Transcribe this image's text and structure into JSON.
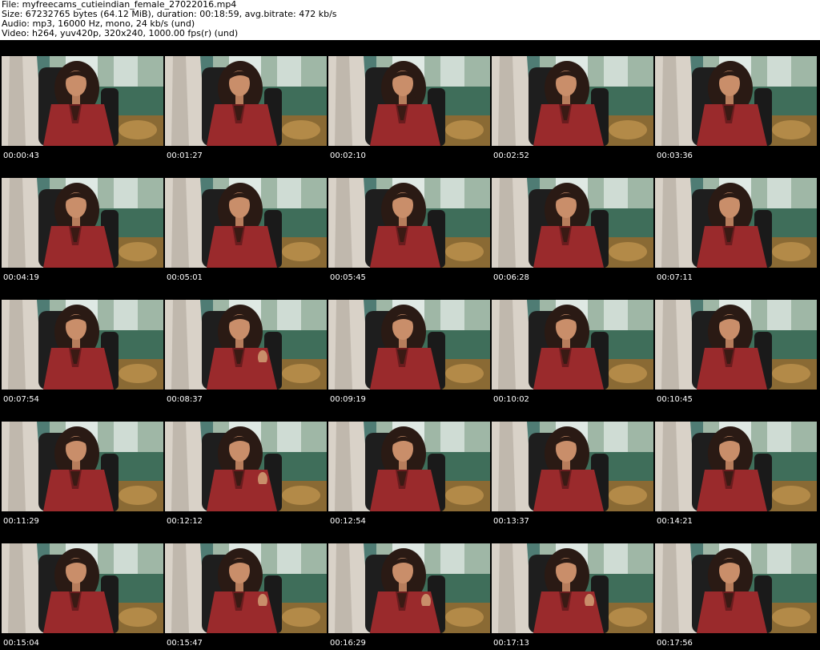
{
  "header": {
    "file_line": "File: myfreecams_cutieindian_female_27022016.mp4",
    "size_line": "Size: 67232765 bytes (64.12 MiB), duration: 00:18:59, avg.bitrate: 472 kb/s",
    "audio_line": "Audio: mp3, 16000 Hz, mono, 24 kb/s (und)",
    "video_line": "Video: h264, yuv420p, 320x240, 1000.00 fps(r) (und)"
  },
  "frames": [
    {
      "timestamp": "00:00:43",
      "pose": "neutral"
    },
    {
      "timestamp": "00:01:27",
      "pose": "neutral"
    },
    {
      "timestamp": "00:02:10",
      "pose": "neutral"
    },
    {
      "timestamp": "00:02:52",
      "pose": "neutral"
    },
    {
      "timestamp": "00:03:36",
      "pose": "neutral"
    },
    {
      "timestamp": "00:04:19",
      "pose": "neutral"
    },
    {
      "timestamp": "00:05:01",
      "pose": "neutral"
    },
    {
      "timestamp": "00:05:45",
      "pose": "neutral"
    },
    {
      "timestamp": "00:06:28",
      "pose": "neutral"
    },
    {
      "timestamp": "00:07:11",
      "pose": "neutral"
    },
    {
      "timestamp": "00:07:54",
      "pose": "neutral"
    },
    {
      "timestamp": "00:08:37",
      "pose": "hand"
    },
    {
      "timestamp": "00:09:19",
      "pose": "neutral"
    },
    {
      "timestamp": "00:10:02",
      "pose": "neutral"
    },
    {
      "timestamp": "00:10:45",
      "pose": "neutral"
    },
    {
      "timestamp": "00:11:29",
      "pose": "neutral"
    },
    {
      "timestamp": "00:12:12",
      "pose": "hand"
    },
    {
      "timestamp": "00:12:54",
      "pose": "neutral"
    },
    {
      "timestamp": "00:13:37",
      "pose": "neutral"
    },
    {
      "timestamp": "00:14:21",
      "pose": "neutral"
    },
    {
      "timestamp": "00:15:04",
      "pose": "neutral"
    },
    {
      "timestamp": "00:15:47",
      "pose": "hand"
    },
    {
      "timestamp": "00:16:29",
      "pose": "hand"
    },
    {
      "timestamp": "00:17:13",
      "pose": "hand"
    },
    {
      "timestamp": "00:17:56",
      "pose": "neutral"
    }
  ],
  "colors": {
    "sheet_background": "#000000",
    "header_background": "#ffffff",
    "header_text": "#000000",
    "timestamp_text": "#ffffff"
  }
}
